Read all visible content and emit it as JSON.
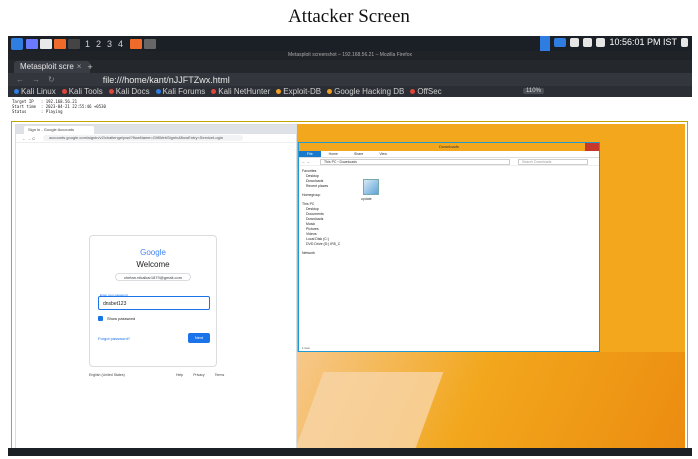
{
  "caption": "Attacker Screen",
  "panel": {
    "workspaces": [
      "1",
      "2",
      "3",
      "4"
    ],
    "clock": "10:56:01 PM IST"
  },
  "browser": {
    "window_title": "Metasploit screenshot – 192.168.56.21 – Mozilla Firefox",
    "tab_label": "Metasploit scre",
    "tab_close": "×",
    "new_tab": "+",
    "url": "file:///home/kant/nJJFTZwx.html",
    "zoom": "110%",
    "bookmarks": [
      {
        "label": "Kali Linux",
        "color": "#2f7de1"
      },
      {
        "label": "Kali Tools",
        "color": "#e0453a"
      },
      {
        "label": "Kali Docs",
        "color": "#e0453a"
      },
      {
        "label": "Kali Forums",
        "color": "#2f7de1"
      },
      {
        "label": "Kali NetHunter",
        "color": "#e0453a"
      },
      {
        "label": "Exploit-DB",
        "color": "#f0a020"
      },
      {
        "label": "Google Hacking DB",
        "color": "#f0a020"
      },
      {
        "label": "OffSec",
        "color": "#e0453a"
      }
    ]
  },
  "session_info": {
    "line1": "Target IP   : 192.168.56.21",
    "line2": "Start time  : 2023-04-21 22:55:46 +0530",
    "line3": "Status      : Playing"
  },
  "victim_chrome": {
    "tab_label": "Sign in - Google Accounts",
    "url": "accounts.google.com/signin/v2/challenge/pwd?flowName=GlifWebSignIn&flowEntry=ServiceLogin",
    "login": {
      "logo": "Google",
      "heading": "Welcome",
      "email": "chetan.nikalkar1879@gmail.com",
      "password_label": "Enter your password",
      "password_value": "dnsbet123",
      "show_password": "Show password",
      "forgot": "Forgot password?",
      "next": "Next"
    },
    "language": "English (United States)",
    "footer": [
      "Help",
      "Privacy",
      "Terms"
    ]
  },
  "victim_explorer": {
    "title": "Downloads",
    "ribbon": [
      "File",
      "Home",
      "Share",
      "View"
    ],
    "path": "This PC › Downloads",
    "search_placeholder": "Search Downloads",
    "nav": [
      "Favorites",
      "Desktop",
      "Downloads",
      "Recent places",
      "Homegroup",
      "This PC",
      "Desktop",
      "Documents",
      "Downloads",
      "Music",
      "Pictures",
      "Videos",
      "Local Disk (C:)",
      "DVD Drive (D:) IR5_C",
      "Network"
    ],
    "file_name": "update",
    "status": "1 item"
  }
}
